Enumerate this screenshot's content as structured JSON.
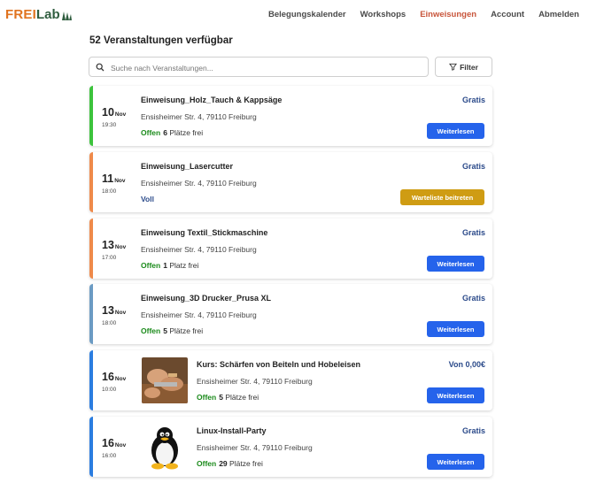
{
  "nav": {
    "logo_frei": "FREI",
    "logo_lab": "Lab",
    "items": [
      "Belegungskalender",
      "Workshops",
      "Einweisungen",
      "Account",
      "Abmelden"
    ],
    "active_index": 2
  },
  "count_label": "52 Veranstaltungen verfügbar",
  "search": {
    "placeholder": "Suche nach Veranstaltungen..."
  },
  "filter_label": "Filter",
  "colors": {
    "green": "#3cc33c",
    "orange": "#ef8a4a",
    "blue_grey": "#6b9bc3",
    "blue": "#2b7de0",
    "button": "#2563eb",
    "waitlist": "#cf9c13",
    "active_nav": "#c8553b",
    "logo_orange": "#e0731f",
    "logo_green": "#2f5d3f"
  },
  "events": [
    {
      "day": "10",
      "month": "Nov",
      "time": "19:30",
      "title": "Einweisung_Holz_Tauch & Kappsäge",
      "address": "Ensisheimer Str. 4, 79110 Freiburg",
      "status": "Offen",
      "places": "6",
      "places_unit": "Plätze frei",
      "price": "Gratis",
      "button": "Weiterlesen",
      "accent": "green",
      "image": ""
    },
    {
      "day": "11",
      "month": "Nov",
      "time": "18:00",
      "title": "Einweisung_Lasercutter",
      "address": "Ensisheimer Str. 4, 79110 Freiburg",
      "status": "Voll",
      "places": "",
      "places_unit": "",
      "price": "Gratis",
      "button": "Warteliste beitreten",
      "accent": "orange",
      "image": ""
    },
    {
      "day": "13",
      "month": "Nov",
      "time": "17:00",
      "title": "Einweisung Textil_Stickmaschine",
      "address": "Ensisheimer Str. 4, 79110 Freiburg",
      "status": "Offen",
      "places": "1",
      "places_unit": "Platz frei",
      "price": "Gratis",
      "button": "Weiterlesen",
      "accent": "orange",
      "image": ""
    },
    {
      "day": "13",
      "month": "Nov",
      "time": "18:00",
      "title": "Einweisung_3D Drucker_Prusa XL",
      "address": "Ensisheimer Str. 4, 79110 Freiburg",
      "status": "Offen",
      "places": "5",
      "places_unit": "Plätze frei",
      "price": "Gratis",
      "button": "Weiterlesen",
      "accent": "blue_grey",
      "image": ""
    },
    {
      "day": "16",
      "month": "Nov",
      "time": "10:00",
      "title": "Kurs: Schärfen von Beiteln und Hobeleisen",
      "address": "Ensisheimer Str. 4, 79110 Freiburg",
      "status": "Offen",
      "places": "5",
      "places_unit": "Plätze frei",
      "price": "Von 0,00€",
      "button": "Weiterlesen",
      "accent": "blue",
      "image": "woodworking-photo"
    },
    {
      "day": "16",
      "month": "Nov",
      "time": "16:00",
      "title": "Linux-Install-Party",
      "address": "Ensisheimer Str. 4, 79110 Freiburg",
      "status": "Offen",
      "places": "29",
      "places_unit": "Plätze frei",
      "price": "Gratis",
      "button": "Weiterlesen",
      "accent": "blue",
      "image": "tux-penguin"
    }
  ]
}
